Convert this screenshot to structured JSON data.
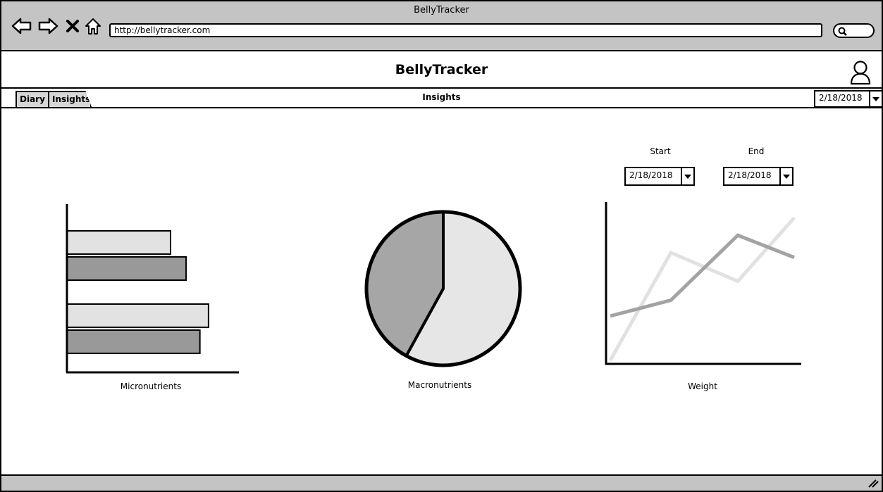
{
  "window": {
    "title": "BellyTracker",
    "url": "http://bellytracker.com",
    "nav_icons": [
      "back-arrow-icon",
      "forward-arrow-icon",
      "close-icon",
      "home-icon"
    ]
  },
  "app": {
    "title": "BellyTracker",
    "user_icon": "user-icon"
  },
  "tabs": [
    {
      "label": "Diary"
    },
    {
      "label": "Insights"
    }
  ],
  "page": {
    "title": "Insights",
    "date": "2/18/2018"
  },
  "range": {
    "start_label": "Start",
    "start_value": "2/18/2018",
    "end_label": "End",
    "end_value": "2/18/2018"
  },
  "charts": {
    "micro_label": "Micronutrients",
    "macro_label": "Macronutrients",
    "weight_label": "Weight"
  },
  "colors": {
    "chrome": "#c4c4c4",
    "light_fill": "#e2e2e2",
    "mid_fill": "#a5a5a5",
    "dark_fill": "#999999"
  },
  "chart_data": [
    {
      "type": "bar",
      "orientation": "horizontal",
      "title": "Micronutrients",
      "categories": [
        "",
        ""
      ],
      "series": [
        {
          "values": [
            0.6,
            0.82
          ]
        },
        {
          "values": [
            0.69,
            0.77
          ]
        }
      ],
      "xlim": [
        0,
        1
      ]
    },
    {
      "type": "pie",
      "title": "Macronutrients",
      "slices": [
        {
          "value": 0.58,
          "color": "#e6e6e6"
        },
        {
          "value": 0.42,
          "color": "#a6a6a6"
        }
      ]
    },
    {
      "type": "line",
      "title": "Weight",
      "x": [
        0,
        1,
        2,
        3
      ],
      "series": [
        {
          "values": [
            0.0,
            0.68,
            0.5,
            0.9
          ],
          "color": "#e1e1e1"
        },
        {
          "values": [
            0.28,
            0.38,
            0.79,
            0.65
          ],
          "color": "#a3a3a3"
        }
      ],
      "ylim": [
        0,
        1
      ]
    }
  ]
}
